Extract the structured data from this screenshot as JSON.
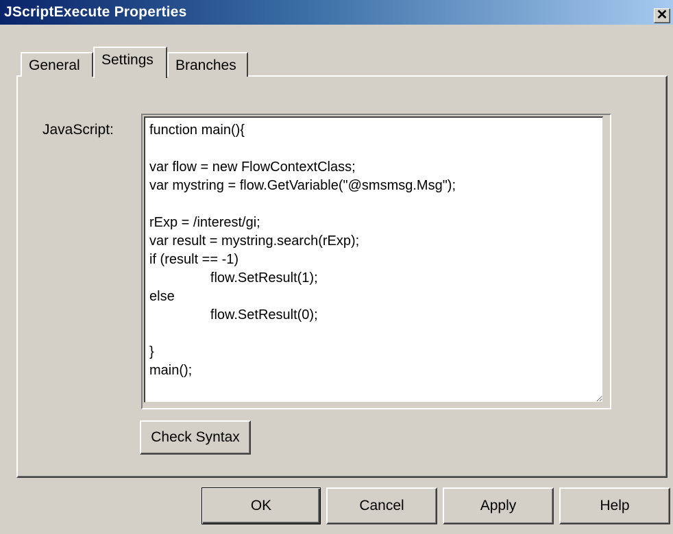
{
  "window": {
    "title": "JScriptExecute Properties",
    "close_glyph": "✕"
  },
  "tabs": [
    {
      "label": "General",
      "active": false
    },
    {
      "label": "Settings",
      "active": true
    },
    {
      "label": "Branches",
      "active": false
    }
  ],
  "settings": {
    "javascript_label": "JavaScript:",
    "code": "function main(){\n\nvar flow = new FlowContextClass;\nvar mystring = flow.GetVariable(\"@smsmsg.Msg\");\n\nrExp = /interest/gi;\nvar result = mystring.search(rExp);\nif (result == -1)\n\t\tflow.SetResult(1);\nelse\n\t\tflow.SetResult(0);\n\n}\nmain();",
    "check_syntax_label": "Check Syntax"
  },
  "buttons": {
    "ok": "OK",
    "cancel": "Cancel",
    "apply": "Apply",
    "help": "Help"
  }
}
